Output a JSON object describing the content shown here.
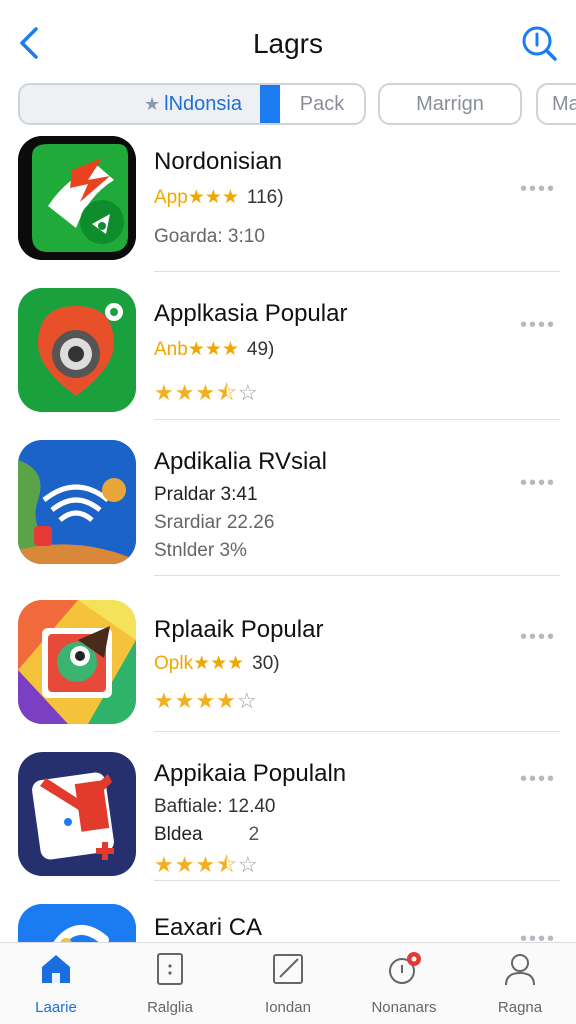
{
  "header": {
    "title": "Lagrs"
  },
  "chips": [
    {
      "label": "lNdonsia"
    },
    {
      "label": "Pack"
    },
    {
      "label": "Marrign"
    },
    {
      "label": "Ma"
    }
  ],
  "apps": [
    {
      "name": "Nordonisian",
      "line1": "App★★★",
      "line1_num": "116)",
      "line2": "Goarda: 3:10"
    },
    {
      "name": "Applkasia Popular",
      "line1": "Anb★★★",
      "line1_num": "49)",
      "rating": 3.5
    },
    {
      "name": "Apdikalia RVsial",
      "line1": "Praldar 3:41",
      "line2": "Srardiar 22.26",
      "line3": "Stnlder 3%"
    },
    {
      "name": "Rplaaik Popular",
      "line1": "Oplk★★★",
      "line1_num": "30)",
      "rating": 4
    },
    {
      "name": "Appikaia Populaln",
      "line1": "Baftiale: 12.40",
      "line2": "Bldea",
      "line2_num": "2",
      "rating": 3.5
    },
    {
      "name": "Eaxari CA"
    }
  ],
  "tabs": [
    {
      "label": "Laarie",
      "icon": "home-icon"
    },
    {
      "label": "Ralglia",
      "icon": "document-icon"
    },
    {
      "label": "Iondan",
      "icon": "edit-icon"
    },
    {
      "label": "Nonanars",
      "icon": "notification-icon"
    },
    {
      "label": "Ragna",
      "icon": "profile-icon"
    }
  ],
  "colors": {
    "accent": "#1a7cf0",
    "star": "#f2b01e",
    "notification": "#e53935"
  }
}
